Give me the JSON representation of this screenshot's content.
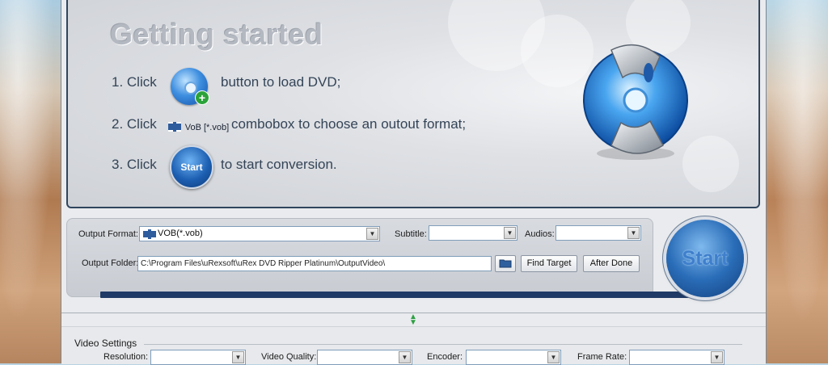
{
  "welcome": {
    "title": "Getting started",
    "step1": {
      "prefix": "1. Click",
      "suffix": "button to load DVD;"
    },
    "step2": {
      "prefix": "2. Click",
      "format_sample": "VoB [*.vob]",
      "suffix": "combobox to choose an outout format;"
    },
    "step3": {
      "prefix": "3. Click",
      "button_label": "Start",
      "suffix": "to start conversion."
    }
  },
  "controls": {
    "output_format_label": "Output Format:",
    "output_format_value": "VOB(*.vob)",
    "subtitle_label": "Subtitle:",
    "subtitle_value": "",
    "audios_label": "Audios:",
    "audios_value": "",
    "output_folder_label": "Output Folder:",
    "output_folder_value": "C:\\Program Files\\uRexsoft\\uRex DVD Ripper Platinum\\OutputVideo\\",
    "find_target_label": "Find Target",
    "after_done_label": "After Done",
    "start_label": "Start"
  },
  "video_settings": {
    "title": "Video Settings",
    "resolution_label": "Resolution:",
    "quality_label": "Video Quality:",
    "encoder_label": "Encoder:",
    "frame_rate_label": "Frame Rate:"
  },
  "colors": {
    "accent": "#1f3a66",
    "start_blue": "#2a6db8"
  },
  "icons": [
    "load-dvd-icon",
    "film-format-icon",
    "start-icon",
    "dvd-disc-logo",
    "folder-icon",
    "dropdown-arrow-icon",
    "splitter-arrow-icon"
  ]
}
